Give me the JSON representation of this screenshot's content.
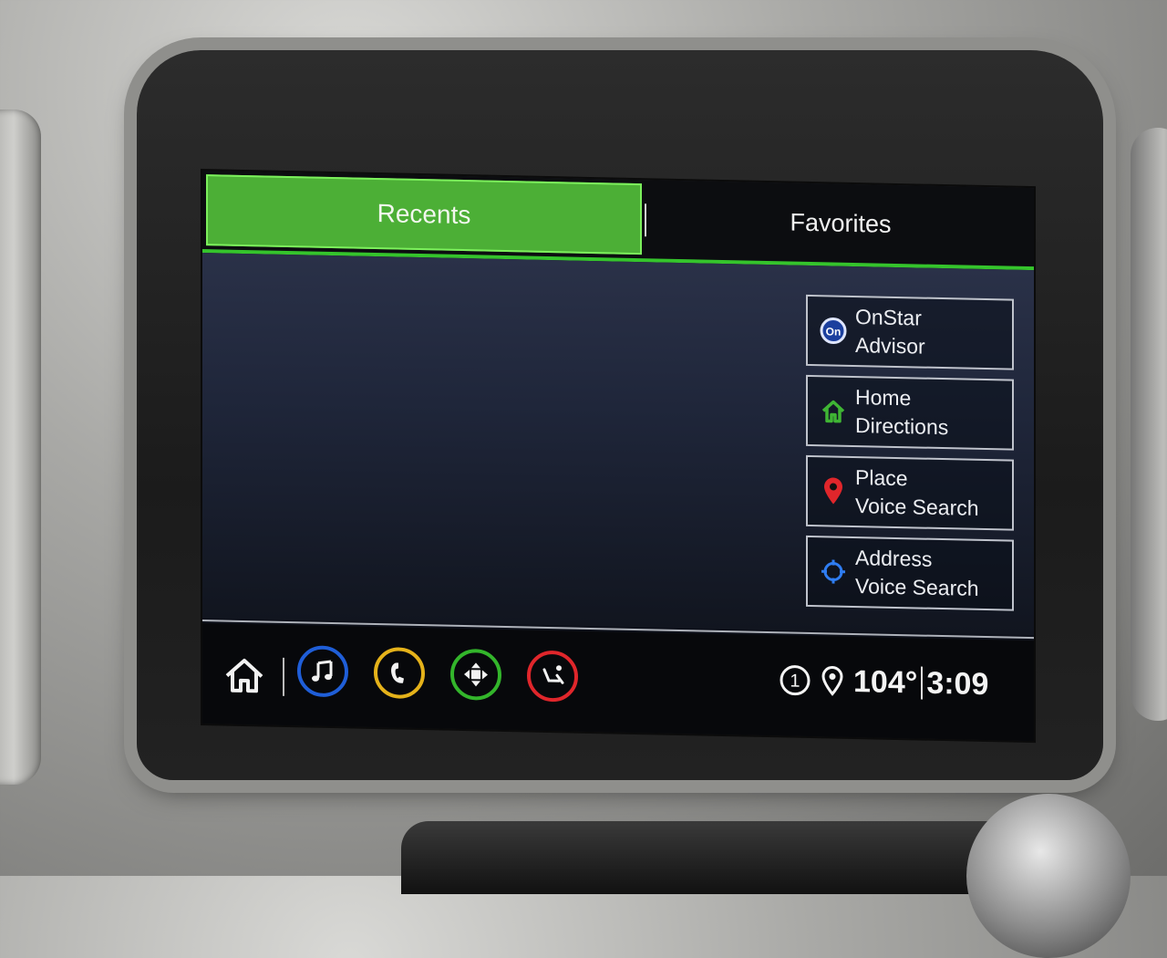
{
  "tabs": {
    "recents_label": "Recents",
    "favorites_label": "Favorites"
  },
  "side_items": [
    {
      "line1": "OnStar",
      "line2": "Advisor",
      "icon": "onstar-icon"
    },
    {
      "line1": "Home",
      "line2": "Directions",
      "icon": "home-icon"
    },
    {
      "line1": "Place",
      "line2": "Voice Search",
      "icon": "location-pin-icon"
    },
    {
      "line1": "Address",
      "line2": "Voice Search",
      "icon": "crosshair-icon"
    }
  ],
  "status_bar": {
    "notification_count": "1",
    "temperature": "104°",
    "time": "3:09"
  },
  "dock": {
    "apps": [
      "home-icon",
      "music-icon",
      "phone-icon",
      "apps-icon",
      "seat-icon"
    ]
  },
  "colors": {
    "accent_green": "#4caf36",
    "music_blue": "#1f5ed8",
    "phone_yellow": "#e5b21a",
    "apps_green": "#33b52b",
    "seat_red": "#e0262b",
    "pin_red": "#e0262b",
    "home_green": "#3fb534"
  }
}
